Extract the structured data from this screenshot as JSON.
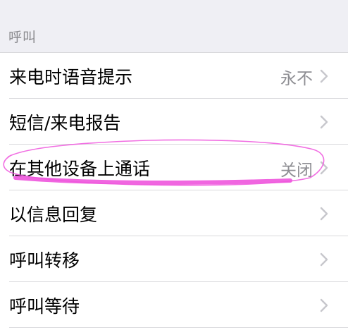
{
  "section": {
    "title": "呼叫"
  },
  "rows": [
    {
      "label": "来电时语音提示",
      "value": "永不"
    },
    {
      "label": "短信/来电报告",
      "value": ""
    },
    {
      "label": "在其他设备上通话",
      "value": "关闭"
    },
    {
      "label": "以信息回复",
      "value": ""
    },
    {
      "label": "呼叫转移",
      "value": ""
    },
    {
      "label": "呼叫等待",
      "value": ""
    }
  ],
  "icons": {
    "row_chevron": "chevron-right-icon"
  },
  "colors": {
    "background": "#efeff4",
    "row_background": "#ffffff",
    "secondary_text": "#8e8e93",
    "separator": "#d9d9dc",
    "chevron": "#c7c7cc",
    "annotation": "#ee55dd"
  }
}
